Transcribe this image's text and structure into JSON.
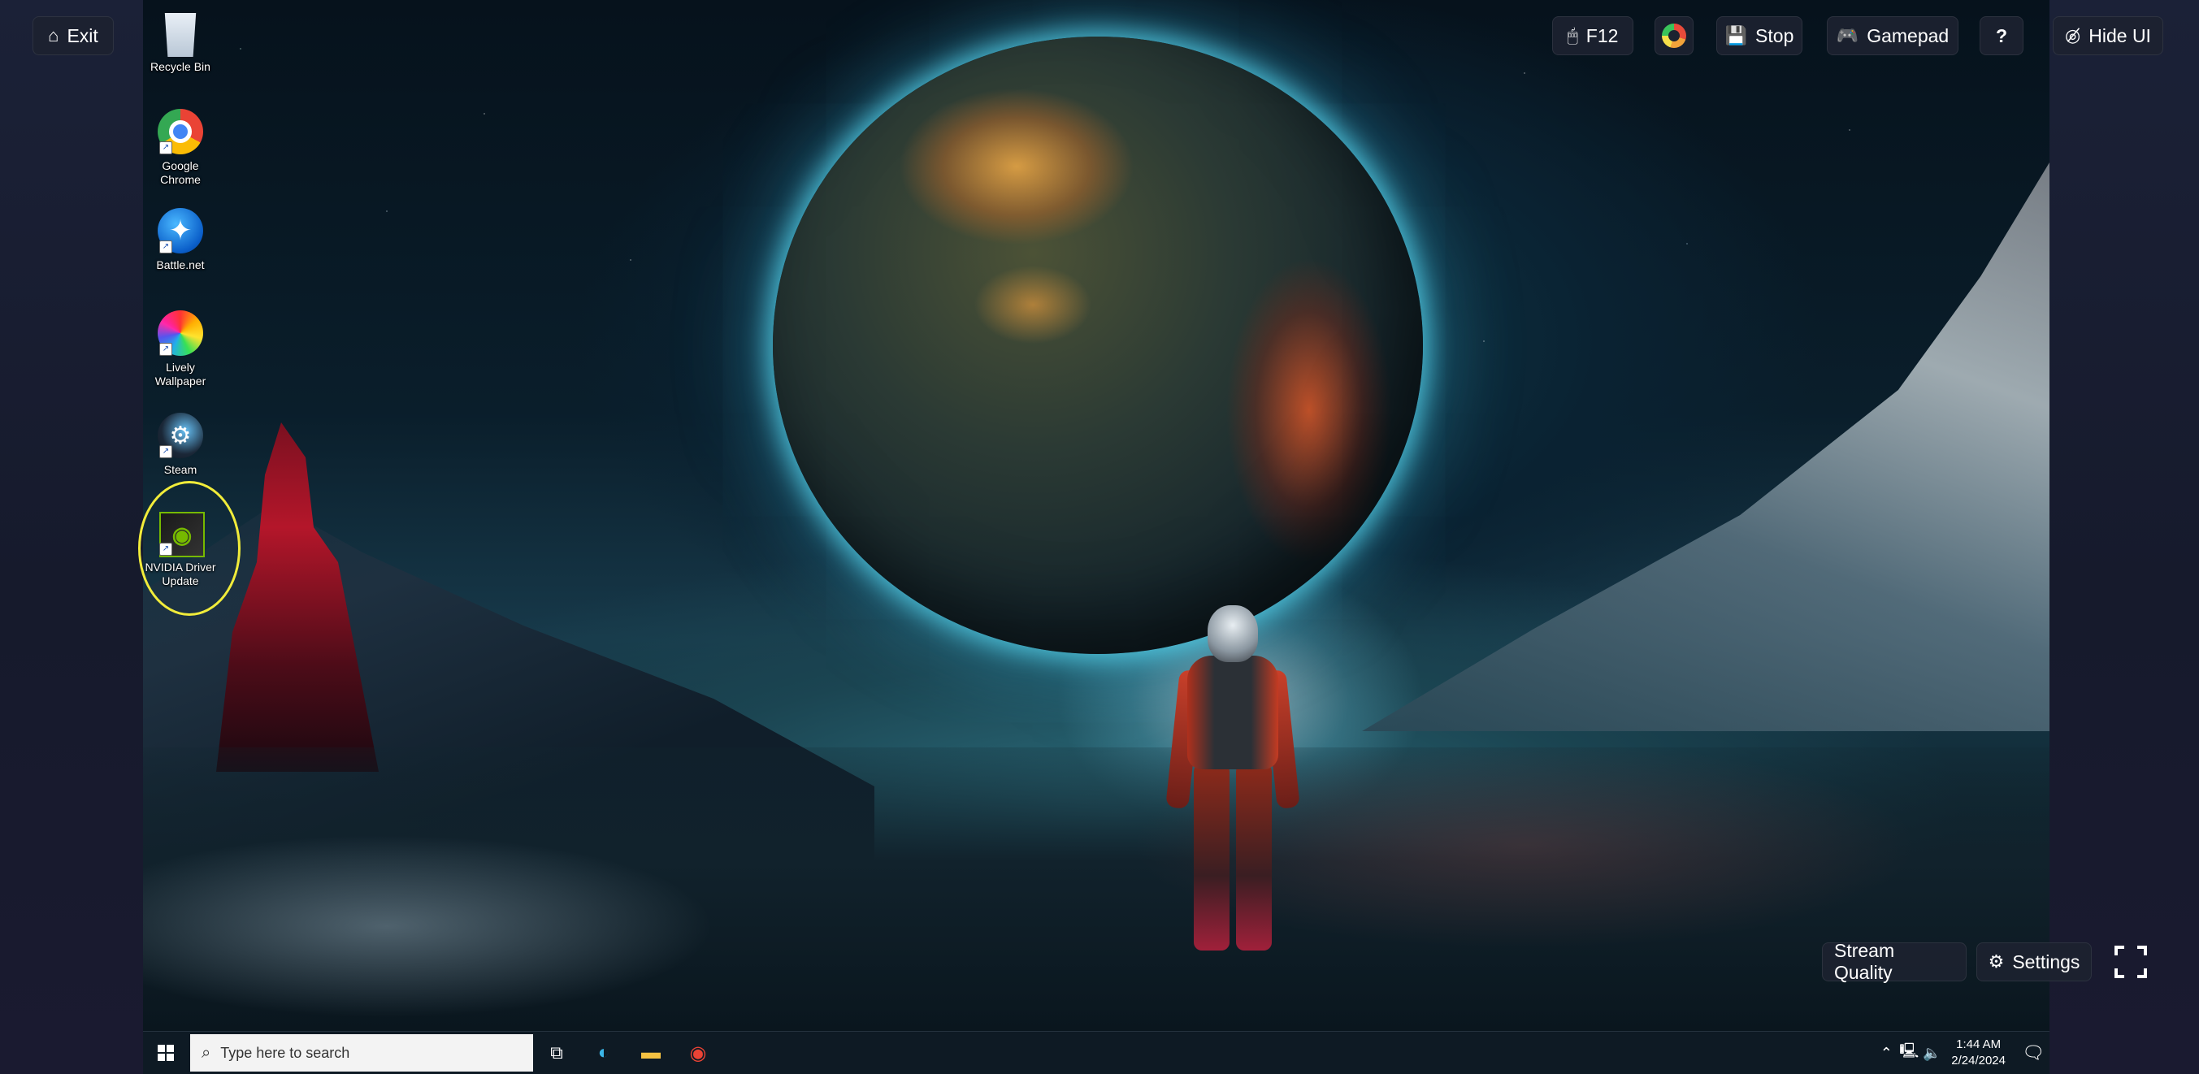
{
  "overlay": {
    "exit_label": "Exit",
    "mouse_key_label": "F12",
    "stop_label": "Stop",
    "gamepad_label": "Gamepad",
    "help_label": "?",
    "hide_ui_label": "Hide UI",
    "stream_quality_label": "Stream Quality",
    "settings_label": "Settings"
  },
  "desktop_icons": [
    {
      "label": "Recycle Bin",
      "icon": "recycle-bin-icon"
    },
    {
      "label": "Google\nChrome",
      "icon": "chrome-icon"
    },
    {
      "label": "Battle.net",
      "icon": "battlenet-icon"
    },
    {
      "label": "Lively\nWallpaper",
      "icon": "lively-wallpaper-icon"
    },
    {
      "label": "Steam",
      "icon": "steam-icon"
    },
    {
      "label": "NVIDIA Driver\nUpdate",
      "icon": "nvidia-icon"
    }
  ],
  "taskbar": {
    "search_placeholder": "Type here to search",
    "clock_time": "1:44 AM",
    "clock_date": "2/24/2024"
  },
  "colors": {
    "highlight": "#f1ec3a",
    "overlay_button_bg": "#1c2230",
    "taskbar_bg": "#0e1a24"
  }
}
